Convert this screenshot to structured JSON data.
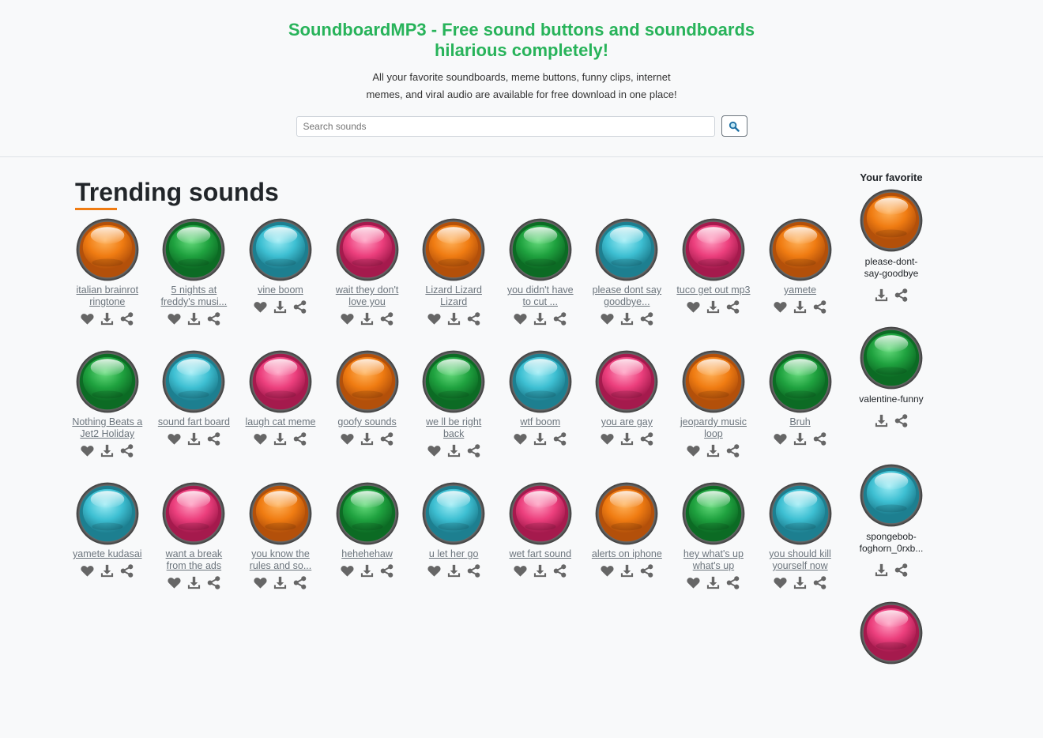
{
  "header": {
    "title": "SoundboardMP3 - Free sound buttons and soundboards hilarious completely!",
    "subtitle": "All your favorite soundboards, meme buttons, funny clips, internet memes, and viral audio are available for free download in one place!",
    "search_placeholder": "Search sounds"
  },
  "trending": {
    "heading": "Trending sounds",
    "sounds": [
      {
        "title": "italian brainrot ringtone",
        "color": "orange"
      },
      {
        "title": "5 nights at freddy's musi...",
        "color": "green"
      },
      {
        "title": "vine boom",
        "color": "cyan"
      },
      {
        "title": "wait they don't love you",
        "color": "pink"
      },
      {
        "title": "Lizard Lizard Lizard",
        "color": "orange"
      },
      {
        "title": "you didn't have to cut ...",
        "color": "green"
      },
      {
        "title": "please dont say goodbye...",
        "color": "cyan"
      },
      {
        "title": "tuco get out mp3",
        "color": "pink"
      },
      {
        "title": "yamete",
        "color": "orange"
      },
      {
        "title": "Nothing Beats a Jet2 Holiday",
        "color": "green"
      },
      {
        "title": "sound fart board",
        "color": "cyan"
      },
      {
        "title": "laugh cat meme",
        "color": "pink"
      },
      {
        "title": "goofy sounds",
        "color": "orange"
      },
      {
        "title": "we ll be right back",
        "color": "green"
      },
      {
        "title": "wtf boom",
        "color": "cyan"
      },
      {
        "title": "you are gay",
        "color": "pink"
      },
      {
        "title": "jeopardy music loop",
        "color": "orange"
      },
      {
        "title": "Bruh",
        "color": "green"
      },
      {
        "title": "yamete kudasai",
        "color": "cyan"
      },
      {
        "title": "want a break from the ads",
        "color": "pink"
      },
      {
        "title": "you know the rules and so...",
        "color": "orange"
      },
      {
        "title": "hehehehaw",
        "color": "green"
      },
      {
        "title": "u let her go",
        "color": "cyan"
      },
      {
        "title": "wet fart sound",
        "color": "pink"
      },
      {
        "title": "alerts on iphone",
        "color": "orange"
      },
      {
        "title": "hey what's up what's up",
        "color": "green"
      },
      {
        "title": "you should kill yourself now",
        "color": "cyan"
      }
    ]
  },
  "favorites": {
    "heading": "Your favorite",
    "items": [
      {
        "title": "please-dont-say-goodbye",
        "color": "orange"
      },
      {
        "title": "valentine-funny",
        "color": "green"
      },
      {
        "title": "spongebob-foghorn_0rxb...",
        "color": "cyan"
      },
      {
        "title": "",
        "color": "pink"
      }
    ]
  },
  "colors": {
    "brand_green": "#28b35a",
    "accent_orange": "#f07c12",
    "icon_gray": "#666666",
    "orange": [
      "#ffb25a",
      "#f07c12",
      "#b3500a"
    ],
    "green": [
      "#67dc7d",
      "#1fa23f",
      "#0c6b24"
    ],
    "cyan": [
      "#9cecf5",
      "#3dbfd2",
      "#1d7f90"
    ],
    "pink": [
      "#ff9cc0",
      "#ec3f7d",
      "#a51a4d"
    ]
  },
  "icons": {
    "like": "heart-icon",
    "download": "download-icon",
    "share": "share-icon",
    "search": "search-icon"
  }
}
